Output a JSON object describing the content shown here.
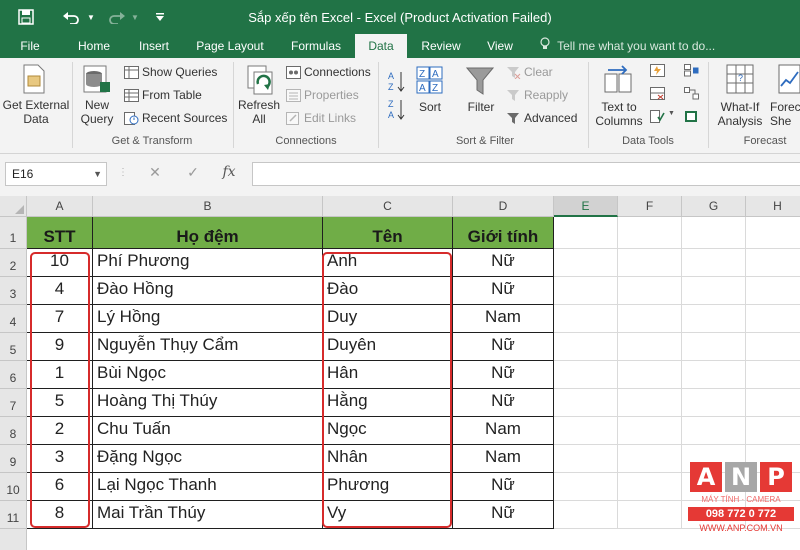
{
  "window": {
    "title": "Sắp xếp tên Excel - Excel (Product Activation Failed)",
    "colors": {
      "brand": "#217346",
      "table_header": "#70ad47",
      "highlight_box": "#d62b2b"
    }
  },
  "quick_access": {
    "save_icon": "save-icon",
    "undo_icon": "undo-icon",
    "redo_icon": "redo-icon",
    "customize_icon": "customize-qat-icon"
  },
  "tabs": [
    {
      "label": "File"
    },
    {
      "label": "Home"
    },
    {
      "label": "Insert"
    },
    {
      "label": "Page Layout"
    },
    {
      "label": "Formulas"
    },
    {
      "label": "Data",
      "active": true
    },
    {
      "label": "Review"
    },
    {
      "label": "View"
    }
  ],
  "tell_me": "Tell me what you want to do...",
  "ribbon": {
    "get_external": "Get External\nData",
    "new_query": "New\nQuery",
    "show_queries": "Show Queries",
    "from_table": "From Table",
    "recent_sources": "Recent Sources",
    "group_get_transform": "Get & Transform",
    "refresh_all": "Refresh\nAll",
    "connections": "Connections",
    "properties": "Properties",
    "edit_links": "Edit Links",
    "group_connections": "Connections",
    "sort": "Sort",
    "filter": "Filter",
    "clear": "Clear",
    "reapply": "Reapply",
    "advanced": "Advanced",
    "group_sort_filter": "Sort & Filter",
    "text_to_columns": "Text to\nColumns",
    "group_data_tools": "Data Tools",
    "what_if": "What-If\nAnalysis",
    "forecast_sheet": "Forec\nShe",
    "group_forecast": "Forecast"
  },
  "formula_bar": {
    "name_box": "E16",
    "formula": ""
  },
  "sheet": {
    "columns": [
      "A",
      "B",
      "C",
      "D",
      "E",
      "F",
      "G",
      "H"
    ],
    "rows": [
      "1",
      "2",
      "3",
      "4",
      "5",
      "6",
      "7",
      "8",
      "9",
      "10",
      "11"
    ],
    "headers": [
      "STT",
      "Họ đệm",
      "Tên",
      "Giới tính"
    ],
    "data": [
      [
        "10",
        "Phí Phương",
        "Anh",
        "Nữ"
      ],
      [
        "4",
        "Đào Hồng",
        "Đào",
        "Nữ"
      ],
      [
        "7",
        "Lý Hồng",
        "Duy",
        "Nam"
      ],
      [
        "9",
        "Nguyễn Thụy Cẩm",
        "Duyên",
        "Nữ"
      ],
      [
        "1",
        "Bùi Ngọc",
        "Hân",
        "Nữ"
      ],
      [
        "5",
        "Hoàng Thị Thúy",
        "Hằng",
        "Nữ"
      ],
      [
        "2",
        "Chu Tuấn",
        "Ngọc",
        "Nam"
      ],
      [
        "3",
        "Đặng Ngọc",
        "Nhân",
        "Nam"
      ],
      [
        "6",
        "Lại Ngọc Thanh",
        "Phương",
        "Nữ"
      ],
      [
        "8",
        "Mai Trần Thúy",
        "Vy",
        "Nữ"
      ]
    ]
  },
  "logo": {
    "letters": [
      "A",
      "N",
      "P"
    ],
    "tagline": "MÁY TÍNH · CAMERA",
    "phone": "098 772 0 772",
    "website": "WWW.ANP.COM.VN"
  }
}
